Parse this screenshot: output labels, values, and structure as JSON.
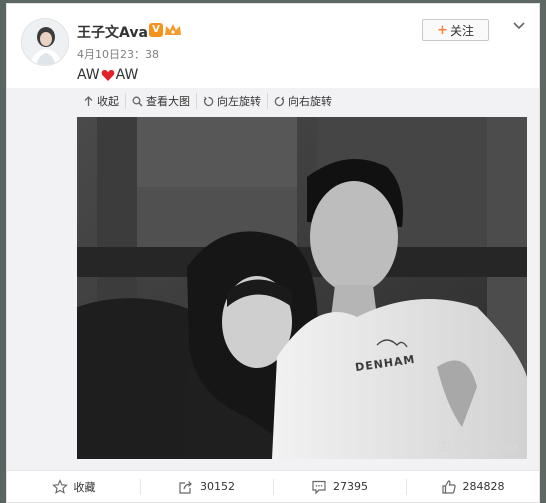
{
  "post": {
    "username": "王子文Ava",
    "verified_badge": "V",
    "timestamp": "4月10日23：38",
    "text_before": "AW",
    "text_after": "AW",
    "heart_color": "#e0232a"
  },
  "follow_button": {
    "plus": "+",
    "label": "关注"
  },
  "toolbar": {
    "collapse_label": "收起",
    "view_large_label": "查看大图",
    "rotate_left_label": "向左旋转",
    "rotate_right_label": "向右旋转"
  },
  "photo": {
    "shirt_text": "DENHAM",
    "watermark": "@王子文Ava"
  },
  "actions": {
    "forward_count": "30152",
    "comment_count": "27395",
    "like_count": "284828"
  },
  "icons": {
    "favorite": "star-icon",
    "forward": "forward-icon",
    "comment": "comment-icon",
    "like": "thumbs-up-icon"
  },
  "colors": {
    "accent": "#ff8140",
    "verified": "#f6911b"
  }
}
